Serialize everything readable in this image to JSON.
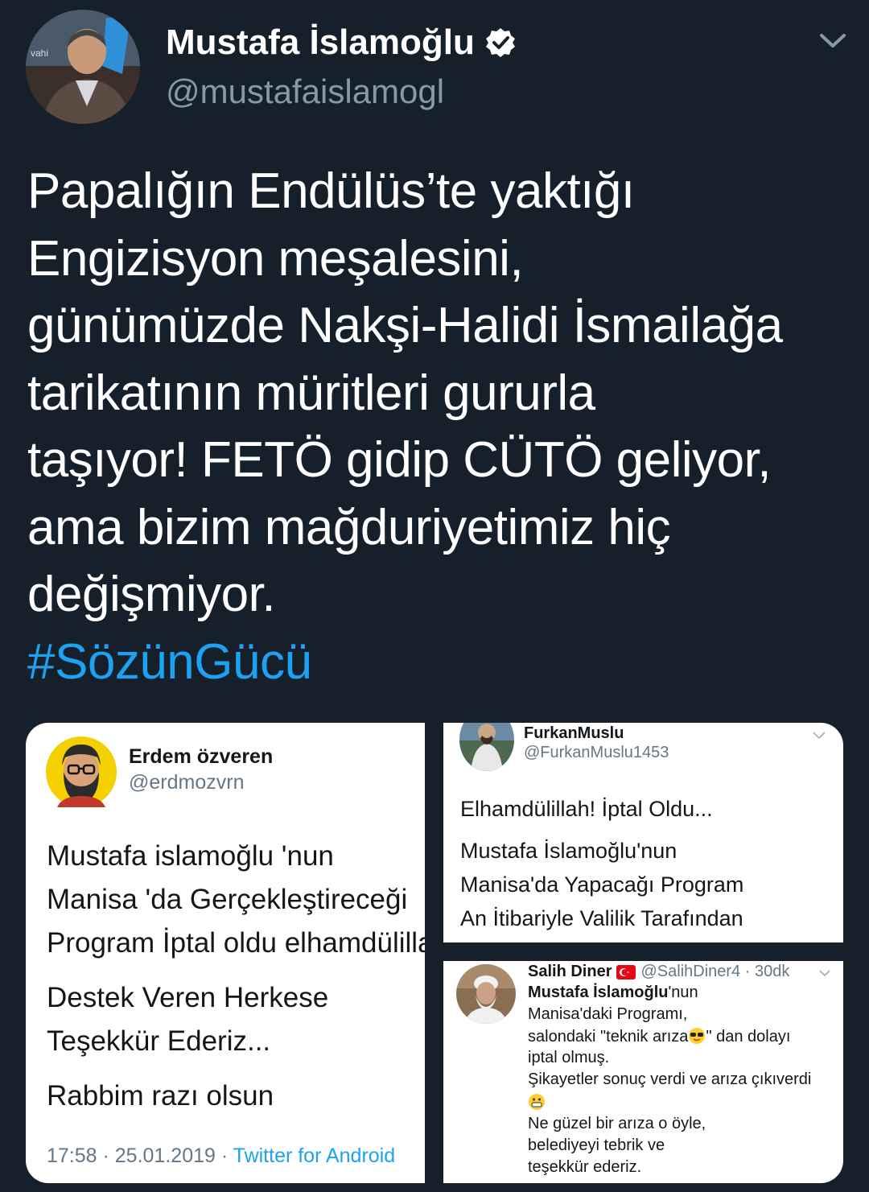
{
  "tweet": {
    "author_name": "Mustafa İslamoğlu",
    "author_handle": "@mustafaislamogl",
    "text_lines": [
      "Papalığın Endülüs’te yaktığı",
      "Engizisyon meşalesini,",
      "günümüzde Nakşi-Halidi İsmailağa",
      "tarikatının müritleri gururla",
      "taşıyor! FETÖ gidip CÜTÖ geliyor,",
      "ama bizim mağduriyetimiz hiç",
      "değişmiyor."
    ],
    "hashtag": "#SözünGücü",
    "avatar_text": "vahi"
  },
  "media": {
    "left": {
      "name": "Erdem özveren",
      "handle": "@erdmozvrn",
      "lines": [
        "Mustafa islamoğlu 'nun",
        "Manisa 'da Gerçekleştireceği",
        "Program İptal oldu elhamdülillah",
        "Destek Veren Herkese",
        "Teşekkür Ederiz...",
        "Rabbim razı olsun"
      ],
      "time": "17:58 · 25.01.2019 · ",
      "source": "Twitter for Android"
    },
    "top_right": {
      "name": "FurkanMuslu",
      "handle": "@FurkanMuslu1453",
      "lines": [
        "Elhamdülillah! İptal Oldu...",
        "Mustafa İslamoğlu'nun",
        "Manisa'da Yapacağı Program",
        "An İtibariyle Valilik Tarafından"
      ]
    },
    "bottom_right": {
      "name": "Salih Diner",
      "handle_time": "@SalihDiner4 · 30dk",
      "bold_name": "Mustafa İslamoğlu",
      "suffix": "'nun",
      "line2": "Manisa'daki Programı,",
      "line3a": "salondaki \"teknik arıza",
      "line3b": "\" dan dolayı",
      "line4": "iptal olmuş.",
      "line5": "Şikayetler sonuç verdi ve arıza çıkıverdi",
      "line7": "Ne güzel bir arıza o öyle,",
      "line8": "belediyeyi tebrik ve",
      "line9": "teşekkür ederiz."
    }
  },
  "colors": {
    "background": "#15202b",
    "link": "#1da1f2",
    "muted": "#8899a6",
    "verified": "#ffffff"
  },
  "icons": [
    "verified-badge-icon",
    "chevron-down-icon",
    "turkey-flag-icon",
    "cool-face-emoji-icon",
    "grin-emoji-icon"
  ]
}
